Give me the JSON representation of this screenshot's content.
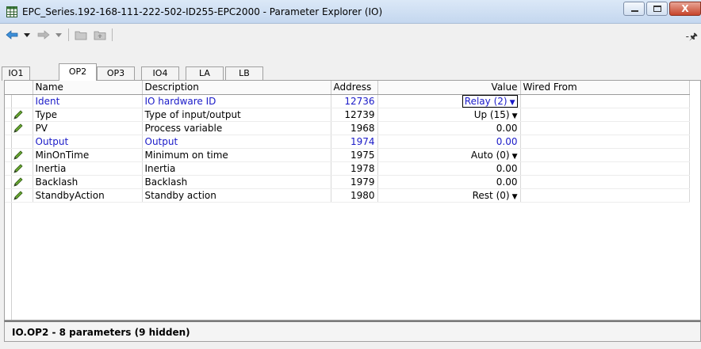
{
  "window": {
    "title": "EPC_Series.192-168-111-222-502-ID255-EPC2000 - Parameter Explorer (IO)",
    "app_icon": "grid-icon",
    "controls": {
      "minimize": "minimize-icon",
      "maximize": "maximize-icon",
      "close_label": "X"
    }
  },
  "toolbar": {
    "items": [
      "back-arrow-icon",
      "chevron-down-icon",
      "forward-arrow-icon",
      "chevron-down-icon",
      "folder-icon",
      "folder-up-icon"
    ],
    "pin": "-🖈"
  },
  "tabs": [
    "IO1",
    "OP2",
    "OP3",
    "IO4",
    "LA",
    "LB"
  ],
  "active_tab": "OP2",
  "grid": {
    "columns": [
      "Name",
      "Description",
      "Address",
      "Value",
      "Wired From"
    ],
    "rows": [
      {
        "pencil": false,
        "name": "Ident",
        "description": "IO hardware ID",
        "address": "12736",
        "value": "Relay (2)",
        "dropdown": true,
        "blue": true,
        "editing": true
      },
      {
        "pencil": true,
        "name": "Type",
        "description": "Type of input/output",
        "address": "12739",
        "value": "Up (15)",
        "dropdown": true,
        "blue": false,
        "editing": false
      },
      {
        "pencil": true,
        "name": "PV",
        "description": "Process variable",
        "address": "1968",
        "value": "0.00",
        "dropdown": false,
        "blue": false,
        "editing": false
      },
      {
        "pencil": false,
        "name": "Output",
        "description": "Output",
        "address": "1974",
        "value": "0.00",
        "dropdown": false,
        "blue": true,
        "editing": false
      },
      {
        "pencil": true,
        "name": "MinOnTime",
        "description": "Minimum on time",
        "address": "1975",
        "value": "Auto (0)",
        "dropdown": true,
        "blue": false,
        "editing": false
      },
      {
        "pencil": true,
        "name": "Inertia",
        "description": "Inertia",
        "address": "1978",
        "value": "0.00",
        "dropdown": false,
        "blue": false,
        "editing": false
      },
      {
        "pencil": true,
        "name": "Backlash",
        "description": "Backlash",
        "address": "1979",
        "value": "0.00",
        "dropdown": false,
        "blue": false,
        "editing": false
      },
      {
        "pencil": true,
        "name": "StandbyAction",
        "description": "Standby action",
        "address": "1980",
        "value": "Rest (0)",
        "dropdown": true,
        "blue": false,
        "editing": false
      }
    ]
  },
  "status": "IO.OP2  -  8 parameters (9 hidden)",
  "colors": {
    "title_bar": "#c4d7ef",
    "link_blue": "#1a1ac8",
    "close_button": "#c7442b"
  }
}
